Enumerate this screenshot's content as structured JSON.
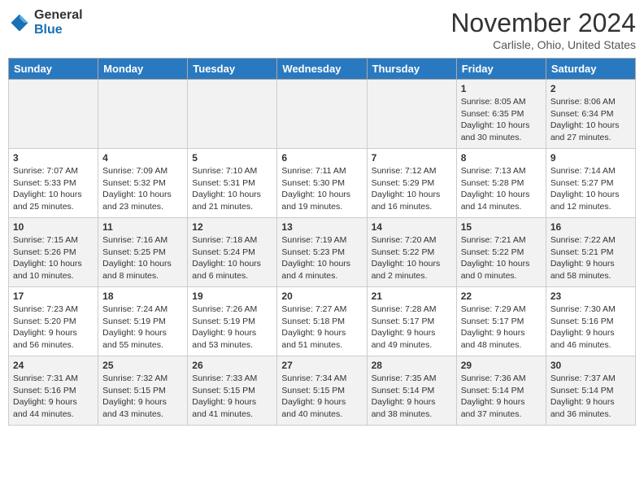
{
  "header": {
    "logo_line1": "General",
    "logo_line2": "Blue",
    "month_year": "November 2024",
    "location": "Carlisle, Ohio, United States"
  },
  "weekdays": [
    "Sunday",
    "Monday",
    "Tuesday",
    "Wednesday",
    "Thursday",
    "Friday",
    "Saturday"
  ],
  "weeks": [
    [
      {
        "day": "",
        "info": ""
      },
      {
        "day": "",
        "info": ""
      },
      {
        "day": "",
        "info": ""
      },
      {
        "day": "",
        "info": ""
      },
      {
        "day": "",
        "info": ""
      },
      {
        "day": "1",
        "info": "Sunrise: 8:05 AM\nSunset: 6:35 PM\nDaylight: 10 hours\nand 30 minutes."
      },
      {
        "day": "2",
        "info": "Sunrise: 8:06 AM\nSunset: 6:34 PM\nDaylight: 10 hours\nand 27 minutes."
      }
    ],
    [
      {
        "day": "3",
        "info": "Sunrise: 7:07 AM\nSunset: 5:33 PM\nDaylight: 10 hours\nand 25 minutes."
      },
      {
        "day": "4",
        "info": "Sunrise: 7:09 AM\nSunset: 5:32 PM\nDaylight: 10 hours\nand 23 minutes."
      },
      {
        "day": "5",
        "info": "Sunrise: 7:10 AM\nSunset: 5:31 PM\nDaylight: 10 hours\nand 21 minutes."
      },
      {
        "day": "6",
        "info": "Sunrise: 7:11 AM\nSunset: 5:30 PM\nDaylight: 10 hours\nand 19 minutes."
      },
      {
        "day": "7",
        "info": "Sunrise: 7:12 AM\nSunset: 5:29 PM\nDaylight: 10 hours\nand 16 minutes."
      },
      {
        "day": "8",
        "info": "Sunrise: 7:13 AM\nSunset: 5:28 PM\nDaylight: 10 hours\nand 14 minutes."
      },
      {
        "day": "9",
        "info": "Sunrise: 7:14 AM\nSunset: 5:27 PM\nDaylight: 10 hours\nand 12 minutes."
      }
    ],
    [
      {
        "day": "10",
        "info": "Sunrise: 7:15 AM\nSunset: 5:26 PM\nDaylight: 10 hours\nand 10 minutes."
      },
      {
        "day": "11",
        "info": "Sunrise: 7:16 AM\nSunset: 5:25 PM\nDaylight: 10 hours\nand 8 minutes."
      },
      {
        "day": "12",
        "info": "Sunrise: 7:18 AM\nSunset: 5:24 PM\nDaylight: 10 hours\nand 6 minutes."
      },
      {
        "day": "13",
        "info": "Sunrise: 7:19 AM\nSunset: 5:23 PM\nDaylight: 10 hours\nand 4 minutes."
      },
      {
        "day": "14",
        "info": "Sunrise: 7:20 AM\nSunset: 5:22 PM\nDaylight: 10 hours\nand 2 minutes."
      },
      {
        "day": "15",
        "info": "Sunrise: 7:21 AM\nSunset: 5:22 PM\nDaylight: 10 hours\nand 0 minutes."
      },
      {
        "day": "16",
        "info": "Sunrise: 7:22 AM\nSunset: 5:21 PM\nDaylight: 9 hours\nand 58 minutes."
      }
    ],
    [
      {
        "day": "17",
        "info": "Sunrise: 7:23 AM\nSunset: 5:20 PM\nDaylight: 9 hours\nand 56 minutes."
      },
      {
        "day": "18",
        "info": "Sunrise: 7:24 AM\nSunset: 5:19 PM\nDaylight: 9 hours\nand 55 minutes."
      },
      {
        "day": "19",
        "info": "Sunrise: 7:26 AM\nSunset: 5:19 PM\nDaylight: 9 hours\nand 53 minutes."
      },
      {
        "day": "20",
        "info": "Sunrise: 7:27 AM\nSunset: 5:18 PM\nDaylight: 9 hours\nand 51 minutes."
      },
      {
        "day": "21",
        "info": "Sunrise: 7:28 AM\nSunset: 5:17 PM\nDaylight: 9 hours\nand 49 minutes."
      },
      {
        "day": "22",
        "info": "Sunrise: 7:29 AM\nSunset: 5:17 PM\nDaylight: 9 hours\nand 48 minutes."
      },
      {
        "day": "23",
        "info": "Sunrise: 7:30 AM\nSunset: 5:16 PM\nDaylight: 9 hours\nand 46 minutes."
      }
    ],
    [
      {
        "day": "24",
        "info": "Sunrise: 7:31 AM\nSunset: 5:16 PM\nDaylight: 9 hours\nand 44 minutes."
      },
      {
        "day": "25",
        "info": "Sunrise: 7:32 AM\nSunset: 5:15 PM\nDaylight: 9 hours\nand 43 minutes."
      },
      {
        "day": "26",
        "info": "Sunrise: 7:33 AM\nSunset: 5:15 PM\nDaylight: 9 hours\nand 41 minutes."
      },
      {
        "day": "27",
        "info": "Sunrise: 7:34 AM\nSunset: 5:15 PM\nDaylight: 9 hours\nand 40 minutes."
      },
      {
        "day": "28",
        "info": "Sunrise: 7:35 AM\nSunset: 5:14 PM\nDaylight: 9 hours\nand 38 minutes."
      },
      {
        "day": "29",
        "info": "Sunrise: 7:36 AM\nSunset: 5:14 PM\nDaylight: 9 hours\nand 37 minutes."
      },
      {
        "day": "30",
        "info": "Sunrise: 7:37 AM\nSunset: 5:14 PM\nDaylight: 9 hours\nand 36 minutes."
      }
    ]
  ]
}
